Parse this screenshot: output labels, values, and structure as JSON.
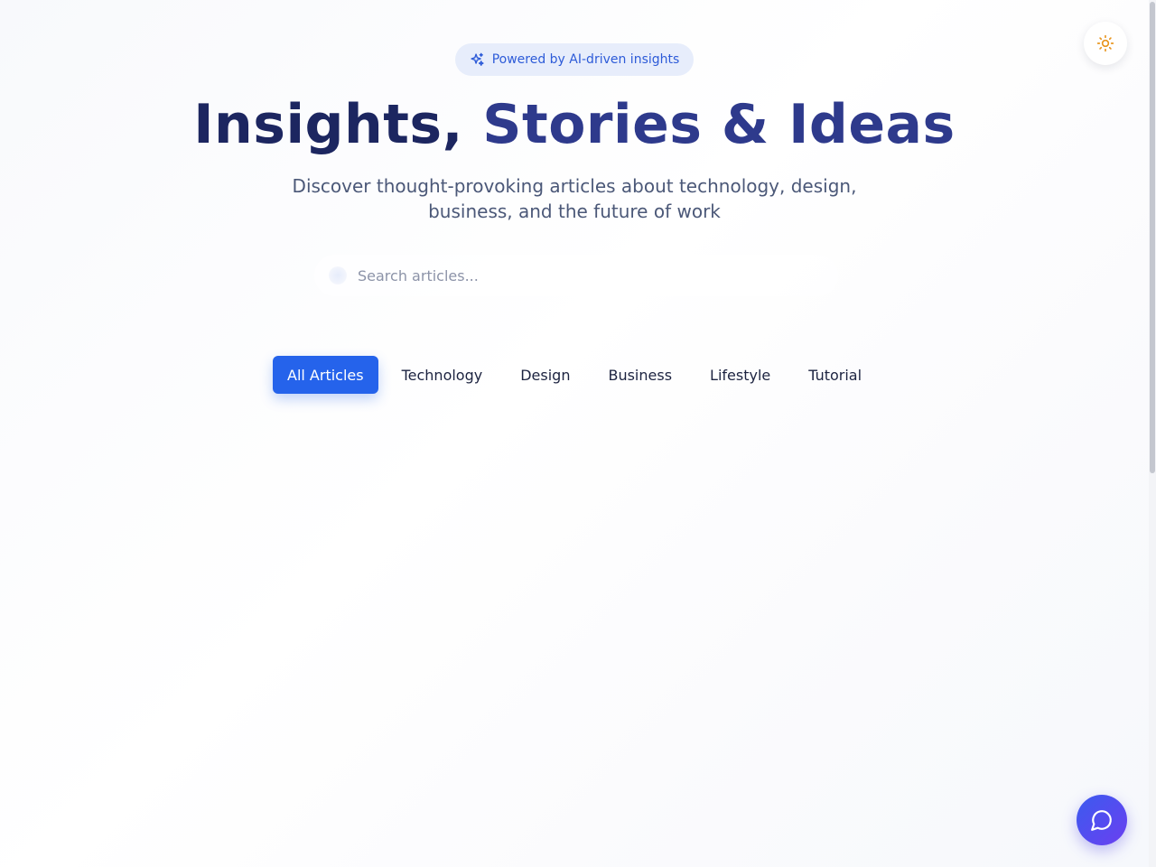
{
  "badge": {
    "text": "Powered by AI-driven insights",
    "icon": "sparkles-icon"
  },
  "hero": {
    "title_part1": "Insights, ",
    "title_part2": "Stories & Ideas",
    "subtitle": "Discover thought-provoking articles about technology, design, business, and the future of work"
  },
  "search": {
    "placeholder": "Search articles...",
    "value": "",
    "icon": "search-icon"
  },
  "filters": [
    {
      "label": "All Articles",
      "active": true
    },
    {
      "label": "Technology",
      "active": false
    },
    {
      "label": "Design",
      "active": false
    },
    {
      "label": "Business",
      "active": false
    },
    {
      "label": "Lifestyle",
      "active": false
    },
    {
      "label": "Tutorial",
      "active": false
    }
  ],
  "theme_toggle": {
    "icon": "sun-icon"
  },
  "chat": {
    "icon": "chat-bubble-icon"
  },
  "colors": {
    "accent": "#2563eb",
    "title_dark": "#1c2660",
    "title_accent": "#2e3a8c",
    "badge_bg": "#e7edfb",
    "badge_text": "#2d5bd8",
    "sun": "#e8951e"
  }
}
